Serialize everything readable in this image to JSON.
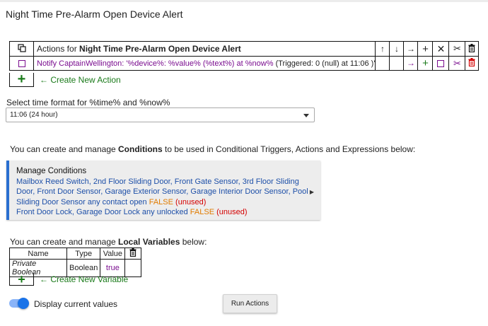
{
  "page": {
    "title": "Night Time Pre-Alarm Open Device Alert"
  },
  "actions_table": {
    "header_prefix": "Actions for ",
    "header_name": "Night Time Pre-Alarm Open Device Alert",
    "header_icons": [
      "copy-icon",
      "arrow-up-icon",
      "arrow-down-icon",
      "arrow-right-icon",
      "plus-icon",
      "close-icon",
      "scissors-icon",
      "trash-icon"
    ],
    "row": {
      "text_main": "Notify CaptainWellington: '%device%: %value% (%text%) at %now%",
      "text_trigger": "(Triggered: 0 (null) at 11:06 )'"
    },
    "create_label": "← Create New Action"
  },
  "time_format": {
    "label": "Select time format for %time% and %now%",
    "selected": "11:06 (24 hour)"
  },
  "conditions": {
    "intro_pre": "You can create and manage ",
    "intro_bold": "Conditions",
    "intro_post": " to be used in Conditional Triggers, Actions and Expressions below:",
    "box_title": "Manage Conditions",
    "line1": "Mailbox Reed Switch, 2nd Floor Sliding Door, Front Gate Sensor, 3rd Floor Sliding",
    "line2": "Door, Front Door Sensor, Garage Exterior Sensor, Garage Interior Door Sensor, Pool",
    "line3_pre": "Sliding Door Sensor any contact open ",
    "line3_false": "FALSE",
    "line3_unused": " (unused)",
    "line4_pre": "Front Door Lock, Garage Door Lock any unlocked ",
    "line4_false": "FALSE",
    "line4_unused": " (unused)"
  },
  "variables": {
    "intro_pre": "You can create and manage ",
    "intro_bold": "Local Variables",
    "intro_post": " below:",
    "headers": [
      "Name",
      "Type",
      "Value"
    ],
    "row": {
      "name": "Private Boolean",
      "type": "Boolean",
      "value": "true"
    },
    "create_label": "← Create New Variable"
  },
  "footer": {
    "toggle_label": "Display current values",
    "run_button": "Run Actions"
  },
  "colors": {
    "accent": "#1a73e8",
    "purple": "#7a0d8f",
    "green": "#1a7a1a",
    "red": "#d40000",
    "orange": "#e07b00",
    "blue": "#1d4fa8"
  }
}
